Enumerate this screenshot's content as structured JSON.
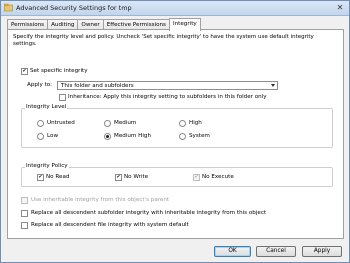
{
  "window": {
    "title": "Advanced Security Settings for tmp"
  },
  "tabs": [
    {
      "label": "Permissions"
    },
    {
      "label": "Auditing"
    },
    {
      "label": "Owner"
    },
    {
      "label": "Effective Permissions"
    },
    {
      "label": "Integrity"
    }
  ],
  "description": "Specify the integrity level and policy.  Uncheck 'Set specific integrity' to have the system use default integrity settings.",
  "set_specific": {
    "label": "Set specific integrity",
    "checked": true
  },
  "apply_to": {
    "label": "Apply to:",
    "value": "This folder and subfolders"
  },
  "inheritance": {
    "label": "Inheritance: Apply this integrity setting to subfolders in this folder only",
    "checked": false
  },
  "integrity_level": {
    "title": "Integrity Level",
    "options": [
      "Untrusted",
      "Medium",
      "High",
      "Low",
      "Medium High",
      "System"
    ],
    "selected": "Medium High"
  },
  "integrity_policy": {
    "title": "Integrity Policy",
    "no_read": "No Read",
    "no_write": "No Write",
    "no_execute": "No Execute"
  },
  "use_inheritable": {
    "label": "Use inheritable integrity from this object's parent"
  },
  "replace_subfolder": {
    "label": "Replace all descendent subfolder integrity with inheritable integrity from this object"
  },
  "replace_file": {
    "label": "Replace all descendent file integrity with system default"
  },
  "buttons": {
    "ok": "OK",
    "cancel": "Cancel",
    "apply": "Apply"
  },
  "check_glyph": "✔",
  "close_glyph": "✕",
  "icons": {
    "window": "shield-folder-icon",
    "close": "close-icon",
    "dropdown": "chevron-down-icon"
  }
}
